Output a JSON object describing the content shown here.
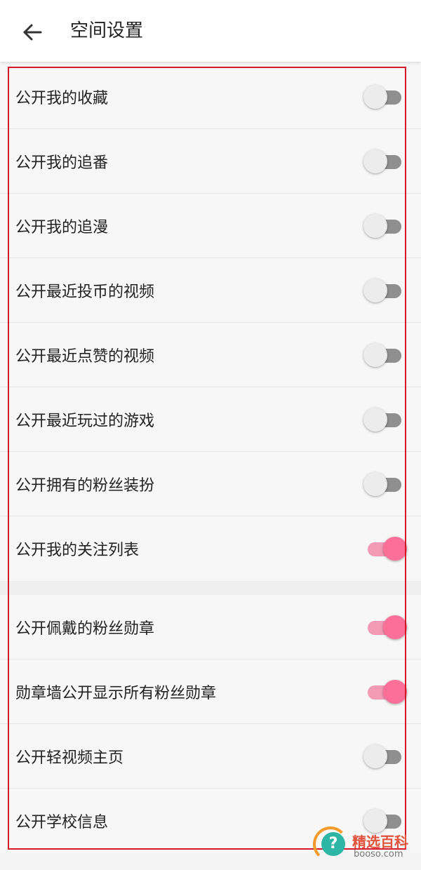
{
  "header": {
    "title": "空间设置",
    "back_icon": "arrow-left-icon"
  },
  "colors": {
    "toggle_on_thumb": "#fb6f98",
    "toggle_on_track": "#f39ab6",
    "toggle_off_track": "#8f8f8f",
    "highlight_border": "#d6182f"
  },
  "settings": [
    {
      "label": "公开我的收藏",
      "on": false
    },
    {
      "label": "公开我的追番",
      "on": false
    },
    {
      "label": "公开我的追漫",
      "on": false
    },
    {
      "label": "公开最近投币的视频",
      "on": false
    },
    {
      "label": "公开最近点赞的视频",
      "on": false
    },
    {
      "label": "公开最近玩过的游戏",
      "on": false
    },
    {
      "label": "公开拥有的粉丝装扮",
      "on": false
    },
    {
      "label": "公开我的关注列表",
      "on": true
    },
    {
      "label": "公开佩戴的粉丝勋章",
      "on": true
    },
    {
      "label": "勋章墙公开显示所有粉丝勋章",
      "on": true
    },
    {
      "label": "公开轻视频主页",
      "on": false
    },
    {
      "label": "公开学校信息",
      "on": false
    }
  ],
  "watermark": {
    "icon": "question-mark-icon",
    "brand": "精选百科",
    "site": "booso.com"
  }
}
